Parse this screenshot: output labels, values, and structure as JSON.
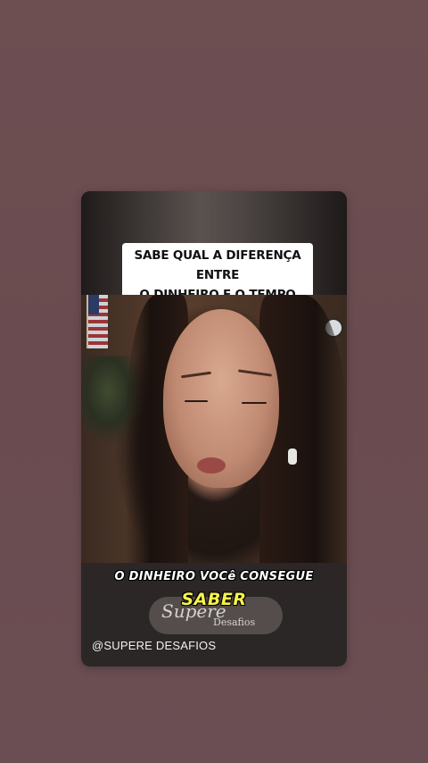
{
  "story": {
    "headline_line1": "SABE QUAL A DIFERENÇA ENTRE",
    "headline_line2": "O DINHEIRO E O TEMPO",
    "caption": "O DINHEIRO VOCê CONSEGUE",
    "highlight": "SABER",
    "watermark_script": "Supere",
    "watermark_small": "Desafios",
    "handle": "@SUPERE DESAFIOS"
  },
  "colors": {
    "background": "#6b4e52",
    "highlight_text": "#f7f24a",
    "headline_bg": "#ffffff"
  }
}
